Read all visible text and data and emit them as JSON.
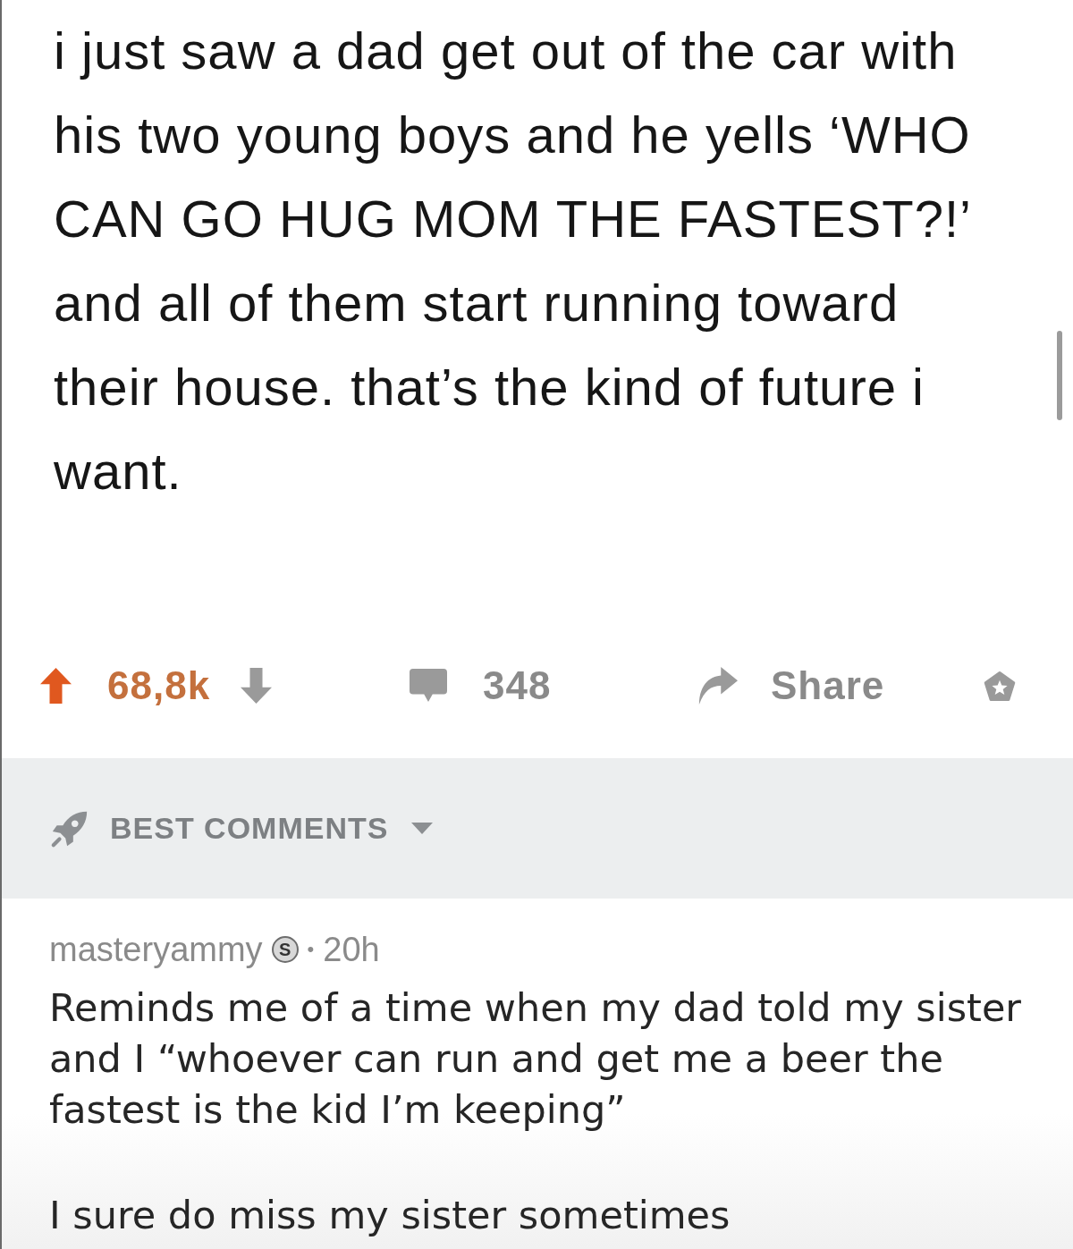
{
  "post": {
    "text": "i just saw a dad get out of the car with his two young boys and he yells ‘WHO CAN GO HUG MOM THE FASTEST?!’ and all of them start running toward their house. that’s the kind of future i want."
  },
  "actions": {
    "vote": {
      "upvoted": true,
      "score": "68,8k"
    },
    "comments": {
      "count": "348"
    },
    "share": {
      "label": "Share"
    }
  },
  "comments_header": {
    "sort_label": "BEST COMMENTS"
  },
  "comments": [
    {
      "author": "masteryammy",
      "badge": "S",
      "separator": "•",
      "age": "20h",
      "paragraphs": [
        "Reminds me of a time when my dad told my sister and I “whoever can run and get me a beer the fastest is the kid I’m keeping”",
        "I sure do miss my sister sometimes"
      ]
    }
  ]
}
